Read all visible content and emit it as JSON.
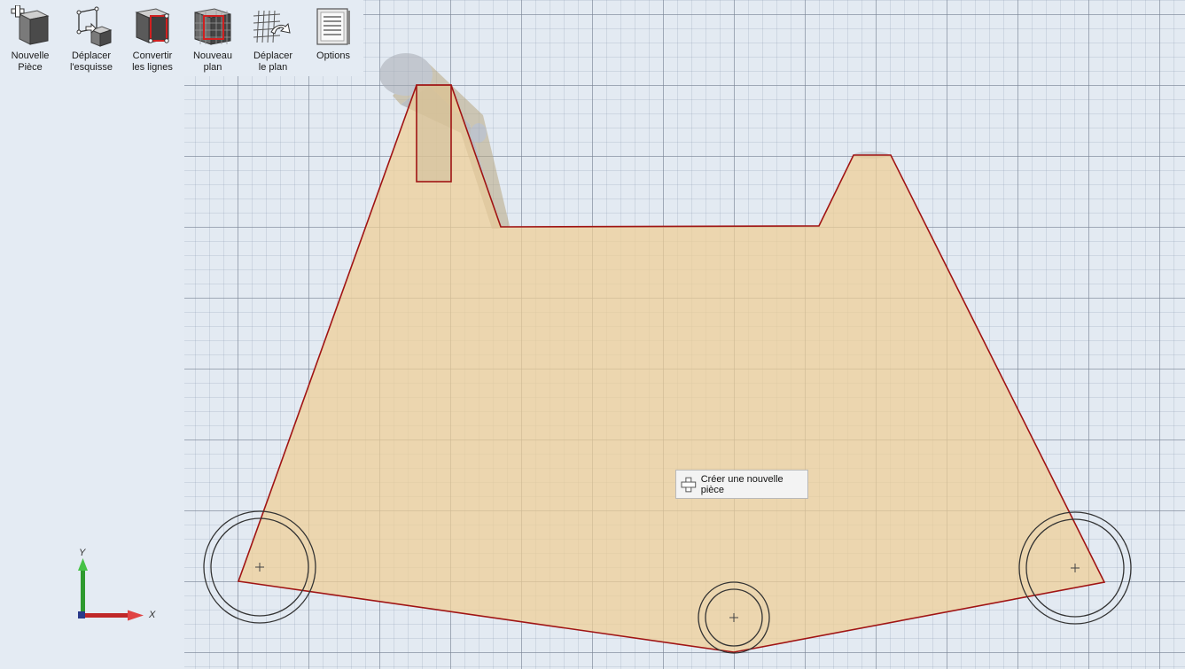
{
  "toolbar": {
    "items": [
      {
        "id": "new-part",
        "line1": "Nouvelle",
        "line2": "Pièce",
        "icon": "new-part-icon"
      },
      {
        "id": "move-sketch",
        "line1": "Déplacer",
        "line2": "l'esquisse",
        "icon": "move-sketch-icon"
      },
      {
        "id": "convert-lines",
        "line1": "Convertir",
        "line2": "les lignes",
        "icon": "convert-lines-icon"
      },
      {
        "id": "new-plane",
        "line1": "Nouveau",
        "line2": "plan",
        "icon": "new-plane-icon"
      },
      {
        "id": "move-plane",
        "line1": "Déplacer",
        "line2": "le plan",
        "icon": "move-plane-icon"
      },
      {
        "id": "options",
        "line1": "Options",
        "line2": "",
        "icon": "options-icon"
      }
    ]
  },
  "tooltip": {
    "text": "Créer une nouvelle pièce",
    "icon": "plus-icon"
  },
  "axis": {
    "y_label": "Y",
    "x_label": "X"
  },
  "colors": {
    "profile_fill": "#f2d4a0",
    "profile_stroke": "#a01414",
    "x_axis": "#d03030",
    "y_axis": "#30b030",
    "grid_bg": "#e3eaf2"
  }
}
